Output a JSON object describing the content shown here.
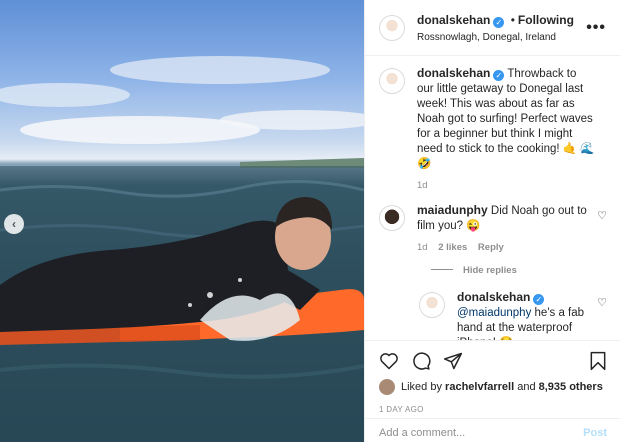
{
  "header": {
    "username": "donalskehan",
    "separator": "•",
    "follow_status": "Following",
    "location": "Rossnowlagh, Donegal, Ireland",
    "more": "•••"
  },
  "caption": {
    "username": "donalskehan",
    "text": "Throwback to our little getaway to Donegal last week! This was about as far as Noah got to surfing! Perfect waves for a beginner but think I might need to stick to the cooking! 🤙 🌊 🤣",
    "time": "1d"
  },
  "comments": [
    {
      "username": "maiadunphy",
      "text": "Did Noah go out to film you? 😜",
      "time": "1d",
      "likes": "2 likes",
      "reply": "Reply"
    }
  ],
  "hide_replies": "Hide replies",
  "reply": {
    "username": "donalskehan",
    "mention": "@maiadunphy",
    "text": " he's a fab hand at the waterproof iPhone! 😂"
  },
  "likes": {
    "prefix": "Liked by ",
    "user": "rachelvfarrell",
    "mid": " and ",
    "count": "8,935 others"
  },
  "posted": "1 DAY AGO",
  "add_comment": {
    "placeholder": "Add a comment...",
    "post": "Post"
  },
  "colors": {
    "verified": "#3897f0",
    "board": "#ff6a2b",
    "wetsuit": "#1d1f24"
  }
}
